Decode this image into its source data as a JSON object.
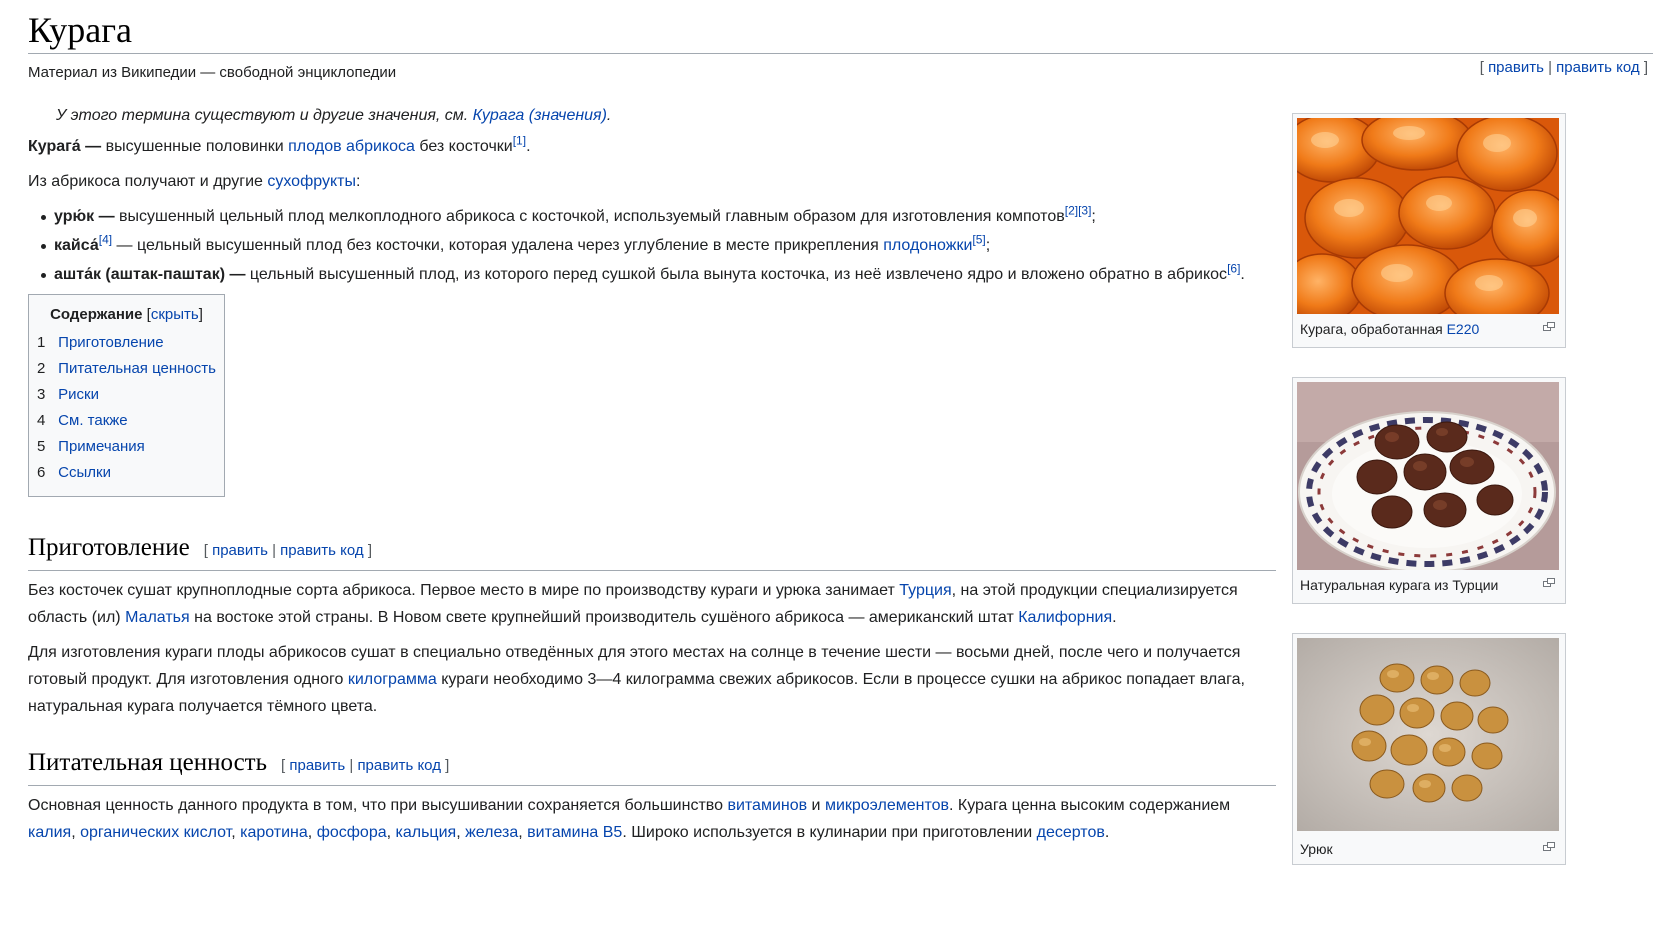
{
  "title": "Курага",
  "tagline": "Материал из Википедии — свободной энциклопедии",
  "top_edit": {
    "edit": "править",
    "edit_code": "править код"
  },
  "hatnote": {
    "text": "У этого термина существуют и другие значения, см. ",
    "link": "Курага (значения)",
    "end": "."
  },
  "intro": {
    "term": "Курага́ —",
    "t1": " высушенные половинки ",
    "link1": "плодов абрикоса",
    "t2": " без косточки",
    "ref": "[1]",
    "end": "."
  },
  "intro2": {
    "t1": "Из абрикоса получают и другие ",
    "link": "сухофрукты",
    "end": ":"
  },
  "defs": [
    {
      "term": "урю́к —",
      "text": " высушенный цельный плод мелкоплодного абрикоса с косточкой, используемый главным образом для изготовления компотов",
      "ref1": "[2]",
      "ref2": "[3]",
      "end": ";"
    },
    {
      "term": "кайса́",
      "ref": "[4]",
      "t1": " — цельный высушенный плод без косточки, которая удалена через углубление в месте прикрепления ",
      "link": "плодоножки",
      "ref2": "[5]",
      "end": ";"
    },
    {
      "term": "ашта́к (аштак-паштак) —",
      "text": " цельный высушенный плод, из которого перед сушкой была вынута косточка, из неё извлечено ядро и вложено обратно в абрикос",
      "ref": "[6]",
      "end": "."
    }
  ],
  "toc": {
    "title": "Содержание",
    "toggle": "скрыть",
    "items": [
      {
        "num": "1",
        "label": "Приготовление"
      },
      {
        "num": "2",
        "label": "Питательная ценность"
      },
      {
        "num": "3",
        "label": "Риски"
      },
      {
        "num": "4",
        "label": "См. также"
      },
      {
        "num": "5",
        "label": "Примечания"
      },
      {
        "num": "6",
        "label": "Ссылки"
      }
    ]
  },
  "sections": {
    "prep": {
      "heading": "Приготовление",
      "p1": {
        "t1": "Без косточек сушат крупноплодные сорта абрикоса. Первое место в мире по производству кураги и урюка занимает ",
        "l1": "Турция",
        "t2": ", на этой продукции специализируется область (ил) ",
        "l2": "Малатья",
        "t3": " на востоке этой страны. В Новом свете крупнейший производитель сушёного абрикоса — американский штат ",
        "l3": "Калифорния",
        "t4": "."
      },
      "p2": {
        "t1": "Для изготовления кураги плоды абрикосов сушат в специально отведённых для этого местах на солнце в течение шести — восьми дней, после чего и получается готовый продукт. Для изготовления одного ",
        "l1": "килограмма",
        "t2": " кураги необходимо 3—4 килограмма свежих абрикосов. Если в процессе сушки на абрикос попадает влага, натуральная курага получается тёмного цвета."
      }
    },
    "nutr": {
      "heading": "Питательная ценность",
      "p1": {
        "t1": "Основная ценность данного продукта в том, что при высушивании сохраняется большинство ",
        "l1": "витаминов",
        "t2": " и ",
        "l2": "микроэлементов",
        "t3": ". Курага ценна высоким содержанием ",
        "l3": "калия",
        "s1": ", ",
        "l4": "органических кислот",
        "s2": ", ",
        "l5": "каротина",
        "s3": ", ",
        "l6": "фосфора",
        "s4": ", ",
        "l7": "кальция",
        "s5": ", ",
        "l8": "железа",
        "s6": ", ",
        "l9": "витамина B5",
        "t4": ". Широко используется в кулинарии при приготовлении ",
        "l10": "десертов",
        "t5": "."
      }
    }
  },
  "section_edit": {
    "edit": "править",
    "edit_code": "править код"
  },
  "figures": [
    {
      "caption_text": "Курага, обработанная ",
      "caption_link": "E220"
    },
    {
      "caption_text": "Натуральная курага из Турции",
      "caption_link": ""
    },
    {
      "caption_text": "Урюк",
      "caption_link": ""
    }
  ],
  "icons": {
    "magnify": "magnify-clip-icon"
  }
}
